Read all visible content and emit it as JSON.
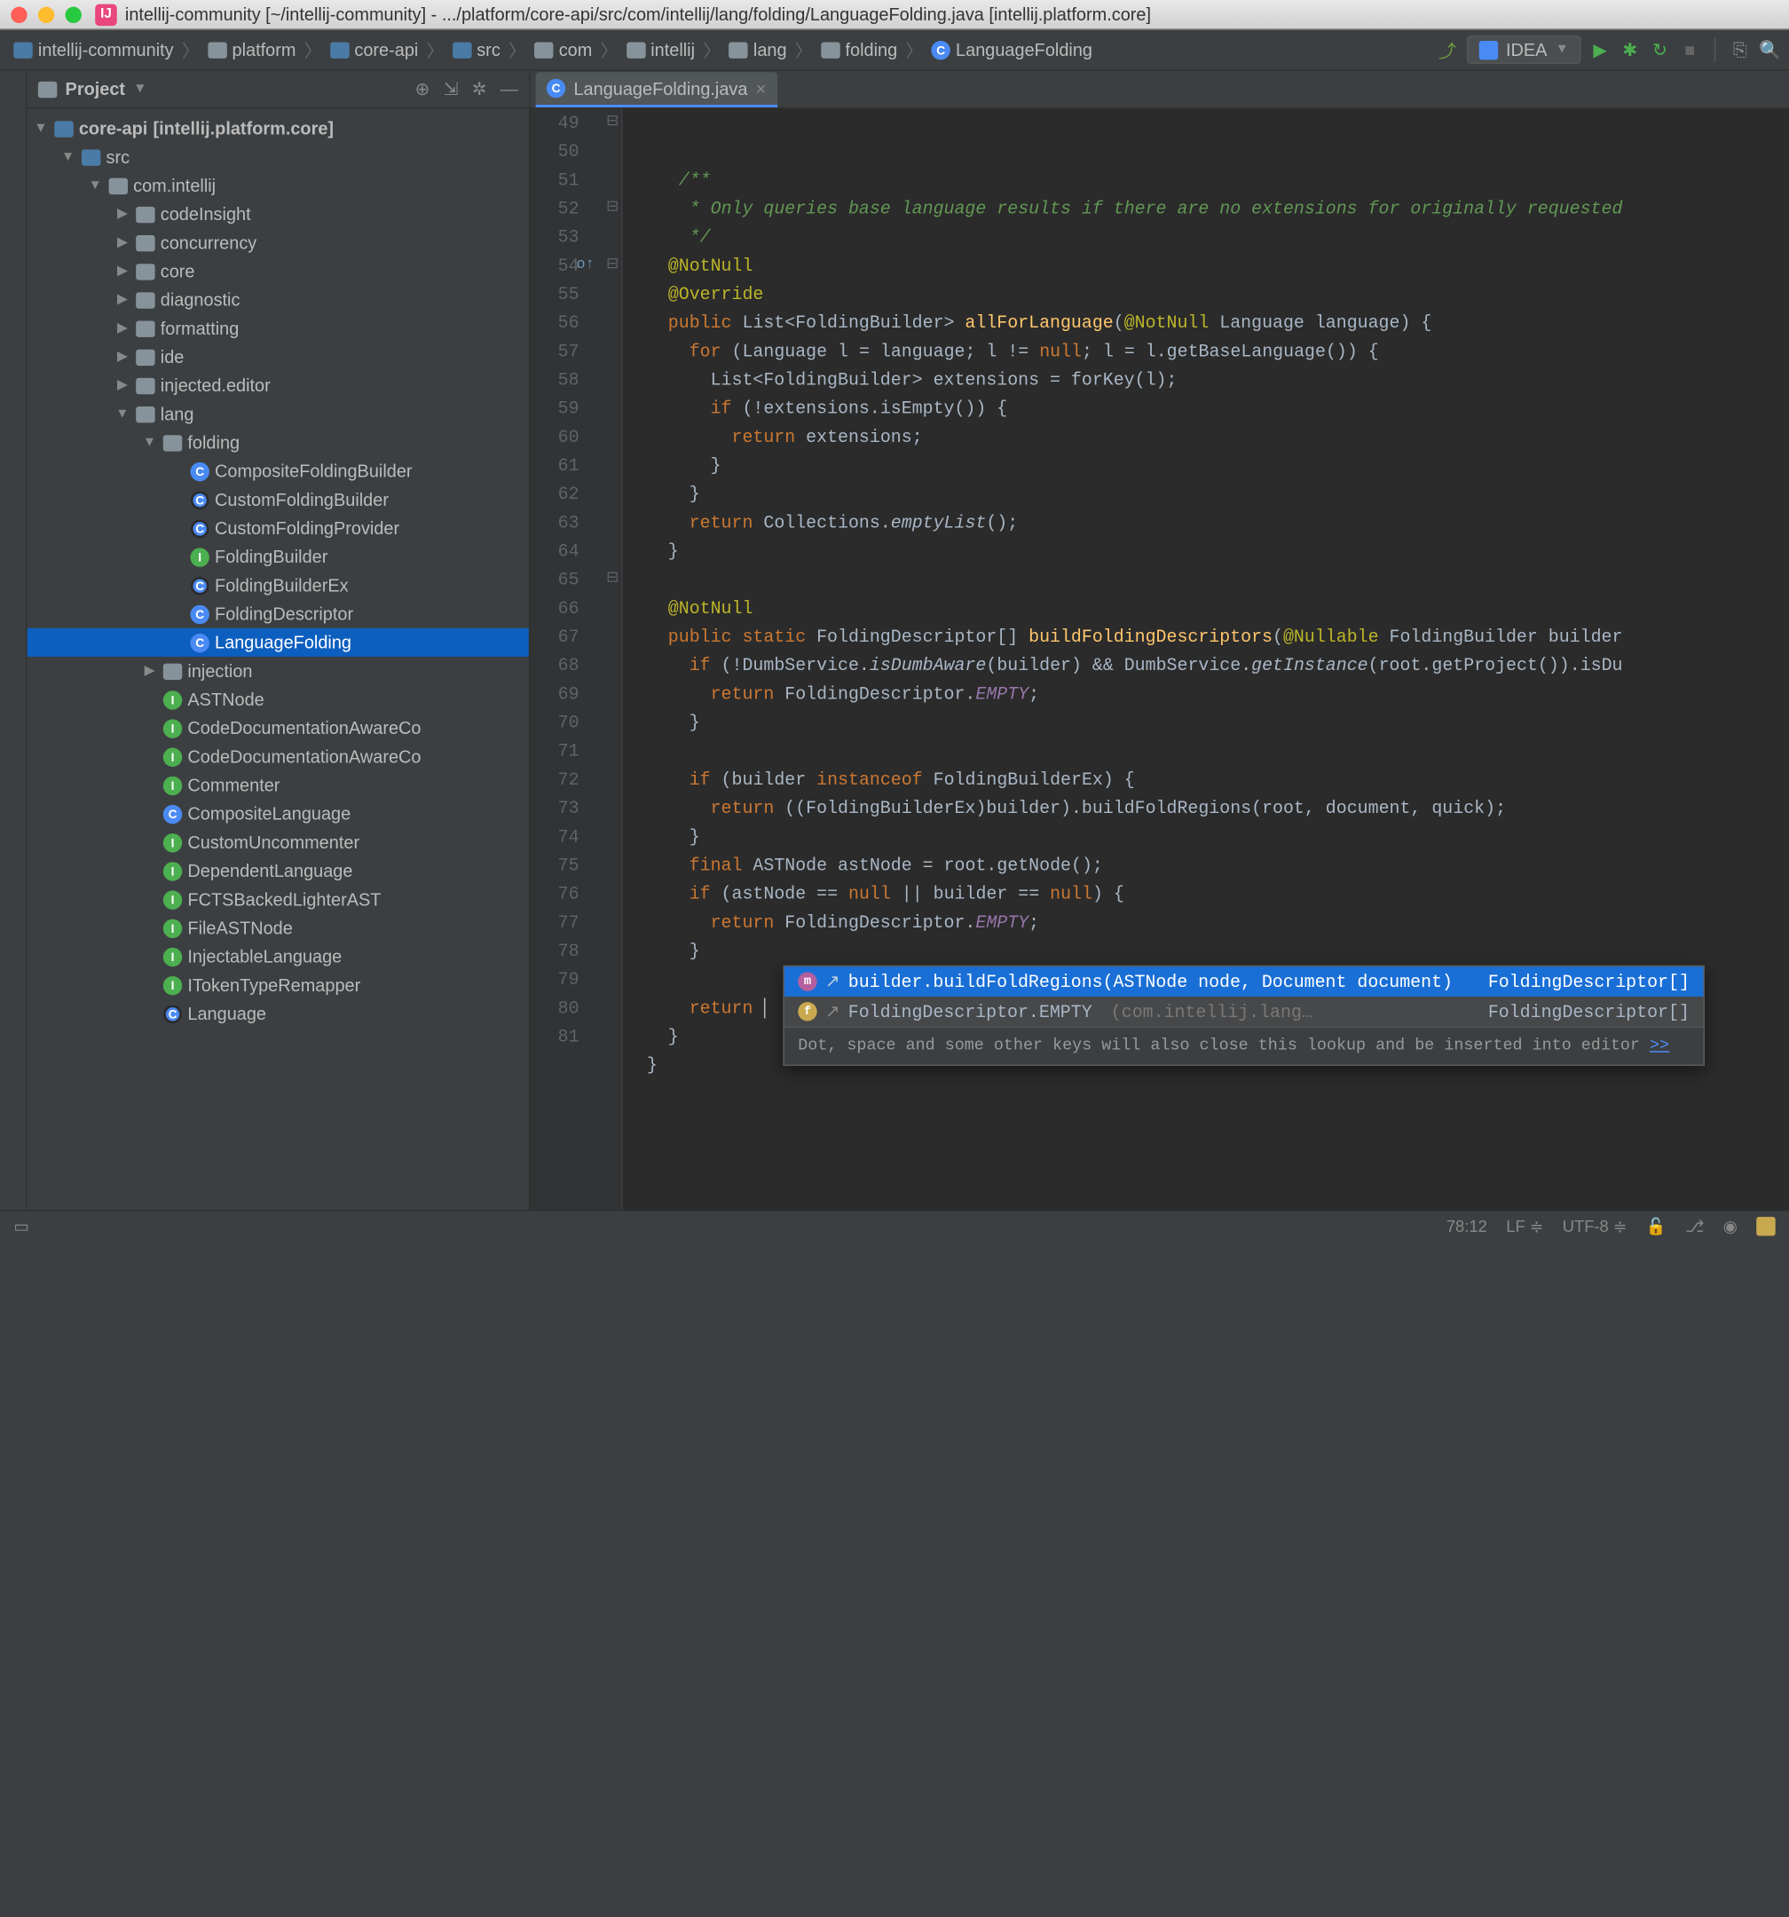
{
  "titlebar": {
    "text": "intellij-community [~/intellij-community] - .../platform/core-api/src/com/intellij/lang/folding/LanguageFolding.java [intellij.platform.core]"
  },
  "breadcrumbs": [
    {
      "icon": "folder-blue",
      "label": "intellij-community"
    },
    {
      "icon": "folder",
      "label": "platform"
    },
    {
      "icon": "folder-blue",
      "label": "core-api"
    },
    {
      "icon": "folder-blue",
      "label": "src"
    },
    {
      "icon": "folder",
      "label": "com"
    },
    {
      "icon": "folder",
      "label": "intellij"
    },
    {
      "icon": "folder",
      "label": "lang"
    },
    {
      "icon": "folder",
      "label": "folding"
    },
    {
      "icon": "class",
      "label": "LanguageFolding"
    }
  ],
  "run_config": "IDEA",
  "project_panel": {
    "title": "Project"
  },
  "tree": [
    {
      "d": 0,
      "arrow": "▼",
      "icon": "folder-blue",
      "label": "core-api",
      "suffix": " [intellij.platform.core]",
      "bold": true
    },
    {
      "d": 1,
      "arrow": "▼",
      "icon": "folder-blue",
      "label": "src"
    },
    {
      "d": 2,
      "arrow": "▼",
      "icon": "folder",
      "label": "com.intellij"
    },
    {
      "d": 3,
      "arrow": "▶",
      "icon": "folder",
      "label": "codeInsight"
    },
    {
      "d": 3,
      "arrow": "▶",
      "icon": "folder",
      "label": "concurrency"
    },
    {
      "d": 3,
      "arrow": "▶",
      "icon": "folder",
      "label": "core"
    },
    {
      "d": 3,
      "arrow": "▶",
      "icon": "folder",
      "label": "diagnostic"
    },
    {
      "d": 3,
      "arrow": "▶",
      "icon": "folder",
      "label": "formatting"
    },
    {
      "d": 3,
      "arrow": "▶",
      "icon": "folder",
      "label": "ide"
    },
    {
      "d": 3,
      "arrow": "▶",
      "icon": "folder",
      "label": "injected.editor"
    },
    {
      "d": 3,
      "arrow": "▼",
      "icon": "folder",
      "label": "lang"
    },
    {
      "d": 4,
      "arrow": "▼",
      "icon": "folder",
      "label": "folding"
    },
    {
      "d": 5,
      "arrow": "",
      "icon": "class",
      "label": "CompositeFoldingBuilder"
    },
    {
      "d": 5,
      "arrow": "",
      "icon": "class-t",
      "label": "CustomFoldingBuilder"
    },
    {
      "d": 5,
      "arrow": "",
      "icon": "class-t",
      "label": "CustomFoldingProvider"
    },
    {
      "d": 5,
      "arrow": "",
      "icon": "iface",
      "label": "FoldingBuilder"
    },
    {
      "d": 5,
      "arrow": "",
      "icon": "class-t",
      "label": "FoldingBuilderEx"
    },
    {
      "d": 5,
      "arrow": "",
      "icon": "class",
      "label": "FoldingDescriptor"
    },
    {
      "d": 5,
      "arrow": "",
      "icon": "class",
      "label": "LanguageFolding",
      "sel": true
    },
    {
      "d": 4,
      "arrow": "▶",
      "icon": "folder",
      "label": "injection"
    },
    {
      "d": 4,
      "arrow": "",
      "icon": "iface",
      "label": "ASTNode"
    },
    {
      "d": 4,
      "arrow": "",
      "icon": "iface",
      "label": "CodeDocumentationAwareCo"
    },
    {
      "d": 4,
      "arrow": "",
      "icon": "iface",
      "label": "CodeDocumentationAwareCo"
    },
    {
      "d": 4,
      "arrow": "",
      "icon": "iface",
      "label": "Commenter"
    },
    {
      "d": 4,
      "arrow": "",
      "icon": "class",
      "label": "CompositeLanguage"
    },
    {
      "d": 4,
      "arrow": "",
      "icon": "iface",
      "label": "CustomUncommenter"
    },
    {
      "d": 4,
      "arrow": "",
      "icon": "iface",
      "label": "DependentLanguage"
    },
    {
      "d": 4,
      "arrow": "",
      "icon": "iface",
      "label": "FCTSBackedLighterAST"
    },
    {
      "d": 4,
      "arrow": "",
      "icon": "iface",
      "label": "FileASTNode"
    },
    {
      "d": 4,
      "arrow": "",
      "icon": "iface",
      "label": "InjectableLanguage"
    },
    {
      "d": 4,
      "arrow": "",
      "icon": "iface",
      "label": "ITokenTypeRemapper"
    },
    {
      "d": 4,
      "arrow": "",
      "icon": "class-t",
      "label": "Language"
    }
  ],
  "tab": {
    "label": "LanguageFolding.java"
  },
  "code_lines": [
    {
      "n": 49,
      "html": "    <span class='c'>/**</span>"
    },
    {
      "n": 50,
      "html": "    <span class='c'> * Only queries base language results if there are no extensions for originally requested</span>"
    },
    {
      "n": 51,
      "html": "    <span class='c'> */</span>"
    },
    {
      "n": 52,
      "html": "   <span class='a'>@NotNull</span>"
    },
    {
      "n": 53,
      "html": "   <span class='a'>@Override</span>"
    },
    {
      "n": 54,
      "html": "   <span class='k'>public </span><span class='t'>List&lt;FoldingBuilder&gt; </span><span class='f'>allForLanguage</span>(<span class='a'>@NotNull</span> Language <span class='w'>language</span>) {",
      "mark": "o↑"
    },
    {
      "n": 55,
      "html": "     <span class='k'>for </span>(Language <span class='w'>l</span> = <span class='w'>language</span>; <span class='w'>l</span> != <span class='k'>null</span>; <span class='w'>l</span> = <span class='w'>l</span>.getBaseLanguage()) {"
    },
    {
      "n": 56,
      "html": "       List&lt;FoldingBuilder&gt; <span class='w'>extensions</span> = forKey(<span class='w'>l</span>);"
    },
    {
      "n": 57,
      "html": "       <span class='k'>if </span>(!<span class='w'>extensions</span>.isEmpty()) {"
    },
    {
      "n": 58,
      "html": "         <span class='k'>return </span><span class='w'>extensions</span>;"
    },
    {
      "n": 59,
      "html": "       }"
    },
    {
      "n": 60,
      "html": "     }"
    },
    {
      "n": 61,
      "html": "     <span class='k'>return </span>Collections.<span class='it'>emptyList</span>();"
    },
    {
      "n": 62,
      "html": "   }"
    },
    {
      "n": 63,
      "html": ""
    },
    {
      "n": 64,
      "html": "   <span class='a'>@NotNull</span>"
    },
    {
      "n": 65,
      "html": "   <span class='k'>public static </span>FoldingDescriptor[] <span class='f'>buildFoldingDescriptors</span>(<span class='a'>@Nullable</span> FoldingBuilder <span class='w'>builder</span>"
    },
    {
      "n": 66,
      "html": "     <span class='k'>if </span>(!DumbService.<span class='it'>isDumbAware</span>(<span class='w'>builder</span>) &amp;&amp; DumbService.<span class='it'>getInstance</span>(<span class='w'>root</span>.getProject()).isDu"
    },
    {
      "n": 67,
      "html": "       <span class='k'>return </span>FoldingDescriptor.<span class='p it'>EMPTY</span>;"
    },
    {
      "n": 68,
      "html": "     }"
    },
    {
      "n": 69,
      "html": ""
    },
    {
      "n": 70,
      "html": "     <span class='k'>if </span>(<span class='w'>builder</span> <span class='k'>instanceof </span>FoldingBuilderEx) {"
    },
    {
      "n": 71,
      "html": "       <span class='k'>return </span>((FoldingBuilderEx)<span class='w'>builder</span>).buildFoldRegions(<span class='w'>root</span>, <span class='w'>document</span>, <span class='w'>quick</span>);"
    },
    {
      "n": 72,
      "html": "     }"
    },
    {
      "n": 73,
      "html": "     <span class='k'>final </span>ASTNode <span class='w'>astNode</span> = <span class='w'>root</span>.getNode();"
    },
    {
      "n": 74,
      "html": "     <span class='k'>if </span>(<span class='w'>astNode</span> == <span class='k'>null </span>|| <span class='w'>builder</span> == <span class='k'>null</span>) {"
    },
    {
      "n": 75,
      "html": "       <span class='k'>return </span>FoldingDescriptor.<span class='p it'>EMPTY</span>;"
    },
    {
      "n": 76,
      "html": "     }"
    },
    {
      "n": 77,
      "html": ""
    },
    {
      "n": 78,
      "html": "     <span class='k'>return </span><span class='caret'> </span>"
    },
    {
      "n": 79,
      "html": "   }"
    },
    {
      "n": 80,
      "html": " }"
    },
    {
      "n": 81,
      "html": ""
    }
  ],
  "completion": {
    "items": [
      {
        "icon": "m",
        "text": "builder.buildFoldRegions(ASTNode node, Document document)",
        "ret": "FoldingDescriptor[]",
        "sel": true
      },
      {
        "icon": "f",
        "text": "FoldingDescriptor.EMPTY",
        "pkg": "(com.intellij.lang…",
        "ret": "FoldingDescriptor[]"
      }
    ],
    "hint": "Dot, space and some other keys will also close this lookup and be inserted into editor",
    "hint_link": ">>"
  },
  "status": {
    "pos": "78:12",
    "le": "LF",
    "enc": "UTF-8"
  }
}
